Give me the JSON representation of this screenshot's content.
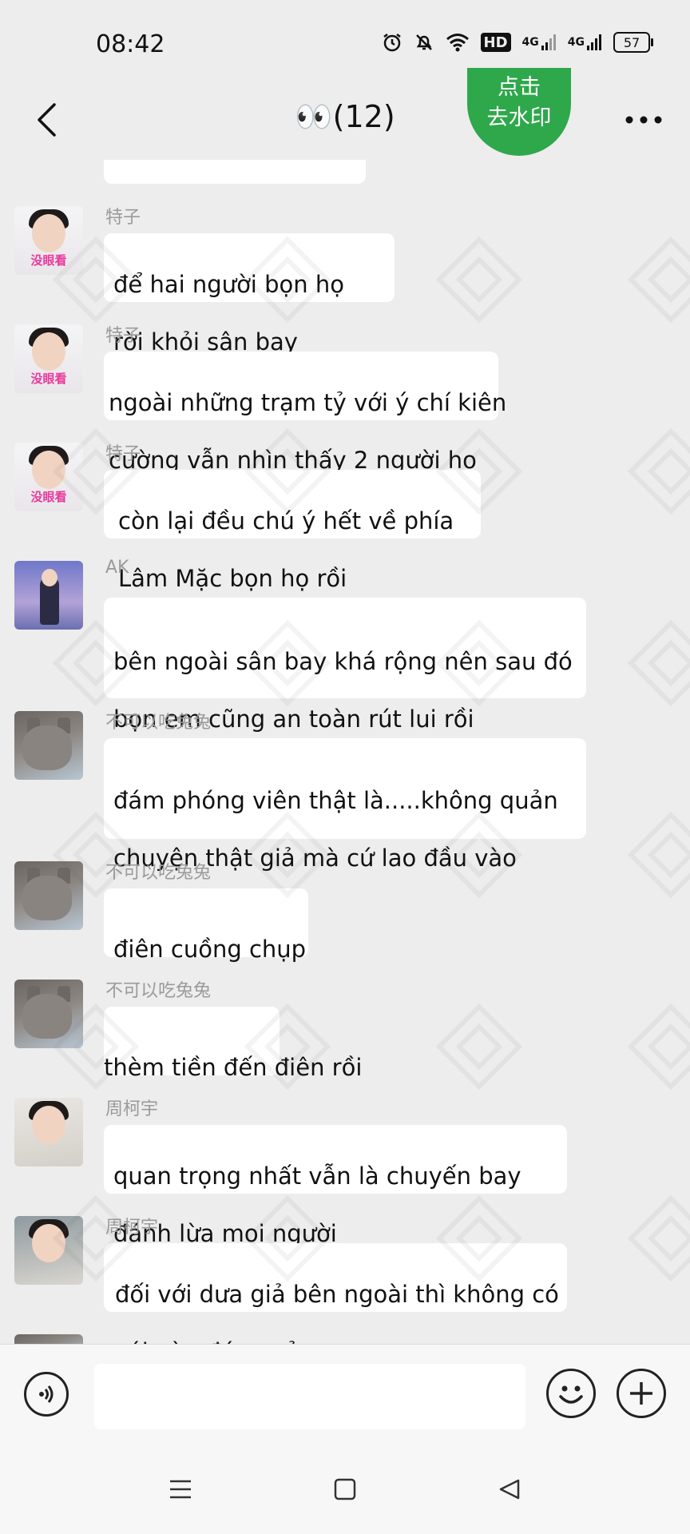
{
  "status_bar": {
    "time": "08:42",
    "network_1": "4G",
    "network_2": "4G",
    "hd_badge": "HD",
    "battery_level": "57"
  },
  "header": {
    "title": "👀(12)"
  },
  "watermark_button": {
    "line1": "点击",
    "line2": "去水印"
  },
  "messages": [
    {
      "sender": "特子",
      "avatar_tag": "没眼看",
      "lines": [
        "để hai người bọn họ",
        "rời khỏi sân bay"
      ]
    },
    {
      "sender": "特子",
      "avatar_tag": "没眼看",
      "lines": [
        "ngoài những trạm tỷ với ý chí kiên",
        "cường vẫn nhìn thấy 2 người họ"
      ]
    },
    {
      "sender": "特子",
      "avatar_tag": "没眼看",
      "lines": [
        "còn lại đều chú ý hết về phía",
        "Lâm Mặc bọn họ rồi"
      ]
    },
    {
      "sender": "AK",
      "avatar_tag": "",
      "lines": [
        "bên ngoài sân bay khá rộng nên sau đó",
        "bọn em cũng an toàn rút lui rồi"
      ]
    },
    {
      "sender": "不可以吃兔兔",
      "avatar_tag": "",
      "lines": [
        "đám phóng viên thật là.....không quản",
        "chuyện thật giả mà cứ lao đầu vào"
      ]
    },
    {
      "sender": "不可以吃兔兔",
      "avatar_tag": "",
      "lines": [
        "điên cuồng chụp"
      ]
    },
    {
      "sender": "不可以吃兔兔",
      "avatar_tag": "",
      "lines": [
        "thèm tiền đến điên rồi"
      ]
    },
    {
      "sender": "周柯宇",
      "avatar_tag": "",
      "lines": [
        "quan trọng nhất vẫn là chuyến bay",
        "đánh lừa mọi người"
      ]
    },
    {
      "sender": "周柯宇",
      "avatar_tag": "",
      "lines": [
        "đối với dưa giả bên ngoài thì không có",
        "cái nào đúng cả"
      ]
    }
  ],
  "input_bar": {
    "placeholder": ""
  },
  "icons": {
    "back": "back-arrow-icon",
    "more": "more-dots-icon",
    "voice": "voice-icon",
    "emoji": "emoji-icon",
    "plus": "plus-icon",
    "menu": "menu-icon",
    "home": "home-icon",
    "back_nav": "back-triangle-icon"
  },
  "colors": {
    "background": "#ededed",
    "bubble": "#ffffff",
    "watermark_button": "#2ea84b",
    "sender_name": "#9a9a9a",
    "avatar_tag": "#e8389b"
  }
}
